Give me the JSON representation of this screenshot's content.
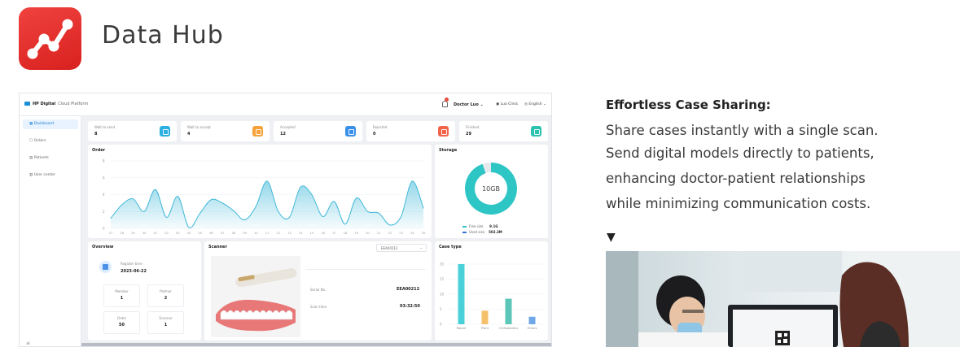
{
  "app": {
    "title": "Data Hub"
  },
  "dashboard": {
    "brand": "HP Digital",
    "brand_sub": "Cloud Platform",
    "doctor": "Doctor Luo",
    "clinic": "Luo Clinic",
    "language": "English",
    "nav": [
      "Dashboard",
      "Orders",
      "Patients",
      "User center"
    ],
    "stats": [
      {
        "label": "Wait to send",
        "value": "8",
        "color": "#2bb0e0"
      },
      {
        "label": "Wait to accept",
        "value": "4",
        "color": "#f5a23a"
      },
      {
        "label": "Accepted",
        "value": "12",
        "color": "#3a8fe8"
      },
      {
        "label": "Rejected",
        "value": "0",
        "color": "#f0644a"
      },
      {
        "label": "Finished",
        "value": "29",
        "color": "#2bc2b0"
      }
    ],
    "order": {
      "title": "Order",
      "y_ticks": [
        "8",
        "6",
        "4",
        "2",
        "0"
      ],
      "x_ticks": [
        "27",
        "28",
        "29",
        "30",
        "01",
        "02",
        "03",
        "04",
        "05",
        "06",
        "07",
        "08",
        "09",
        "10",
        "11",
        "12",
        "13",
        "14",
        "15",
        "16",
        "17",
        "18",
        "19",
        "20",
        "21",
        "22",
        "23",
        "24",
        "25"
      ]
    },
    "storage": {
      "title": "Storage",
      "center": "10GB",
      "free_label": "Free size",
      "free_value": "9.1G",
      "used_label": "Used size",
      "used_value": "502.3M"
    },
    "overview": {
      "title": "Overview",
      "register_label": "Register time",
      "register_value": "2023-06-22",
      "cells": [
        {
          "label": "Member",
          "value": "1"
        },
        {
          "label": "Partner",
          "value": "2"
        },
        {
          "label": "Order",
          "value": "50"
        },
        {
          "label": "Scanner",
          "value": "1"
        }
      ]
    },
    "scanner": {
      "title": "Scanner",
      "select_value": "EEA00212",
      "serial_label": "Serial No.",
      "serial_value": "EEA00212",
      "scan_time_label": "Scan time",
      "scan_time_value": "03:32:50"
    },
    "case_type": {
      "title": "Case type",
      "y_ticks": [
        "20",
        "15",
        "10",
        "5",
        "0"
      ],
      "categories": [
        "Repair",
        "Plant",
        "Orthodontics",
        "Others"
      ]
    }
  },
  "chart_data": [
    {
      "type": "line",
      "title": "Order",
      "x": [
        "27",
        "28",
        "29",
        "30",
        "01",
        "02",
        "03",
        "04",
        "05",
        "06",
        "07",
        "08",
        "09",
        "10",
        "11",
        "12",
        "13",
        "14",
        "15",
        "16",
        "17",
        "18",
        "19",
        "20",
        "21",
        "22",
        "23",
        "24",
        "25"
      ],
      "values": [
        1.2,
        2.8,
        3.5,
        2.0,
        4.6,
        1.3,
        3.8,
        0.1,
        1.8,
        3.4,
        3.0,
        2.1,
        1.0,
        2.6,
        5.6,
        2.0,
        1.3,
        4.9,
        4.0,
        1.4,
        3.2,
        0.5,
        3.6,
        2.0,
        1.8,
        0.4,
        1.4,
        5.6,
        2.4
      ],
      "ylim": [
        0,
        8
      ],
      "color": "#3fb8d8"
    },
    {
      "type": "pie",
      "title": "Storage",
      "labels": [
        "Free size",
        "Used size"
      ],
      "values": [
        9.1,
        0.5023
      ],
      "colors": [
        "#2ec5c5",
        "#e6e9ee"
      ]
    },
    {
      "type": "bar",
      "title": "Case type",
      "categories": [
        "Repair",
        "Plant",
        "Orthodontics",
        "Others"
      ],
      "values": [
        20,
        4.5,
        8.5,
        2.5
      ],
      "colors": [
        "#4ad0d8",
        "#f5c06a",
        "#5cc6b8",
        "#6fa8e8"
      ],
      "ylim": [
        0,
        20
      ]
    }
  ],
  "feature": {
    "title": "Effortless Case Sharing:",
    "lines": [
      "Share cases instantly with a single scan.",
      "Send digital models directly to patients,",
      "enhancing doctor-patient relationships",
      "while minimizing communication costs."
    ],
    "arrow": "▼"
  }
}
